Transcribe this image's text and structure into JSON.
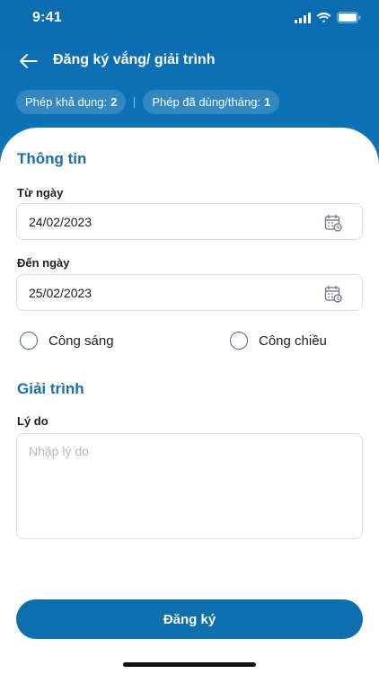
{
  "status_bar": {
    "time": "9:41"
  },
  "header": {
    "title": "Đăng ký vắng/ giải trình",
    "chips": {
      "available_label": "Phép khả dụng:",
      "available_value": "2",
      "used_label": "Phép đã dùng/tháng:",
      "used_value": "1"
    }
  },
  "info_section": {
    "title": "Thông tin",
    "from_date": {
      "label": "Từ ngày",
      "value": "24/02/2023"
    },
    "to_date": {
      "label": "Đến ngày",
      "value": "25/02/2023"
    },
    "options": [
      {
        "label": "Công sáng",
        "selected": false
      },
      {
        "label": "Công chiều",
        "selected": false
      }
    ]
  },
  "explanation_section": {
    "title": "Giải trình",
    "reason_label": "Lý do",
    "reason_placeholder": "Nhập lý do",
    "reason_value": ""
  },
  "submit_label": "Đăng ký",
  "colors": {
    "primary": "#0e6fae",
    "section_title": "#1a6fa8",
    "border": "#dcdfe3"
  },
  "icons": [
    "back-arrow-icon",
    "calendar-icon",
    "signal-icon",
    "wifi-icon",
    "battery-icon"
  ]
}
